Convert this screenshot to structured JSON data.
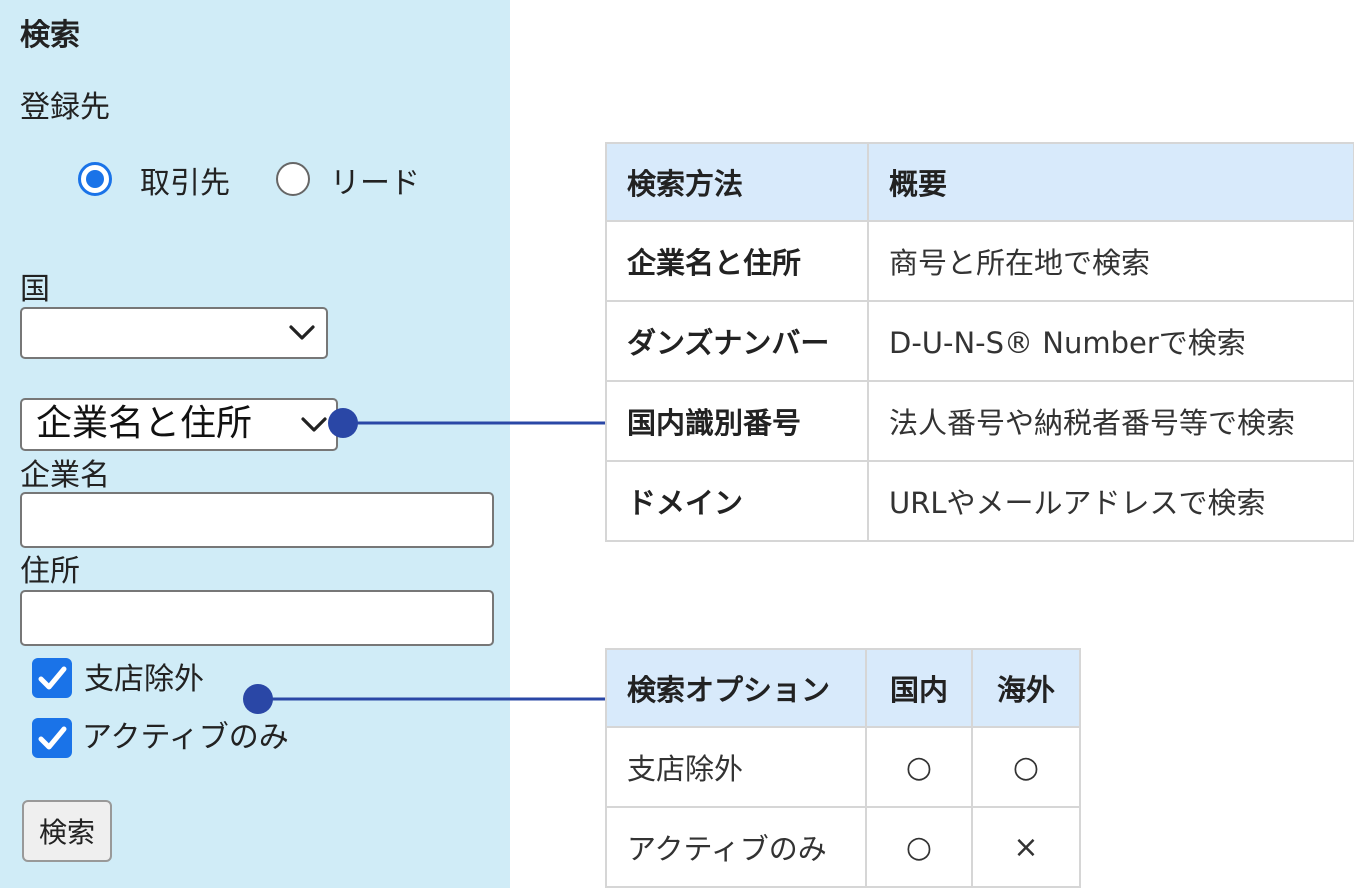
{
  "panel": {
    "title": "検索",
    "destination_label": "登録先",
    "radios": [
      {
        "label": "取引先",
        "checked": true
      },
      {
        "label": "リード",
        "checked": false
      }
    ],
    "country_label": "国",
    "country_value": "",
    "method_value": "企業名と住所",
    "company_label": "企業名",
    "company_value": "",
    "address_label": "住所",
    "address_value": "",
    "checkboxes": [
      {
        "label": "支店除外",
        "checked": true
      },
      {
        "label": "アクティブのみ",
        "checked": true
      }
    ],
    "search_button": "検索",
    "accent_color": "#1a73e8",
    "background_color": "#d0ecf7"
  },
  "method_table": {
    "headers": [
      "検索方法",
      "概要"
    ],
    "rows": [
      [
        "企業名と住所",
        "商号と所在地で検索"
      ],
      [
        "ダンズナンバー",
        "D-U-N-S® Numberで検索"
      ],
      [
        "国内識別番号",
        "法人番号や納税者番号等で検索"
      ],
      [
        "ドメイン",
        "URLやメールアドレスで検索"
      ]
    ]
  },
  "option_table": {
    "headers": [
      "検索オプション",
      "国内",
      "海外"
    ],
    "rows": [
      [
        "支店除外",
        "○",
        "○"
      ],
      [
        "アクティブのみ",
        "○",
        "×"
      ]
    ]
  },
  "connector_color": "#2a47a6",
  "header_color": "#d8eafb"
}
